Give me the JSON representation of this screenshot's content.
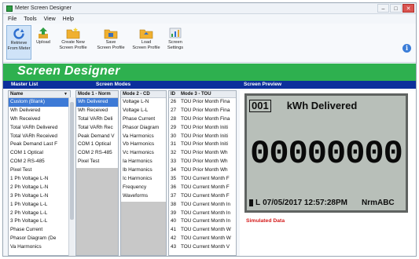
{
  "window": {
    "title": "Meter Screen Designer"
  },
  "menu": [
    "File",
    "Tools",
    "View",
    "Help"
  ],
  "toolbar": {
    "buttons": [
      {
        "label": "Retrieve\nFrom Meter",
        "icon": "refresh-icon",
        "active": true
      },
      {
        "label": "Upload",
        "icon": "upload-icon"
      },
      {
        "label": "Create New\nScreen Profile",
        "icon": "folder-new-icon"
      },
      {
        "label": "Save\nScreen Profile",
        "icon": "save-folder-icon"
      },
      {
        "label": "Load\nScreen Profile",
        "icon": "load-folder-icon"
      },
      {
        "label": "Screen\nSettings",
        "icon": "settings-chart-icon"
      }
    ]
  },
  "banner": {
    "title": "Screen Designer",
    "color": "#2eb04f"
  },
  "sections": {
    "master": "Master List",
    "modes": "Screen Modes",
    "preview": "Screen Preview"
  },
  "columns": {
    "name": {
      "header": "Name",
      "items": [
        "Custom (Blank)",
        "Wh Delivered",
        "Wh Received",
        "Total VARh Delivered",
        "Total VARh Received",
        "Peak Demand Last F",
        "COM 1 Optical",
        "COM 2 RS-485",
        "Pixel Test",
        "1 Ph Voltage L-N",
        "2 Ph Voltage L-N",
        "3 Ph Voltage L-N",
        "1 Ph Voltage L-L",
        "2 Ph Voltage L-L",
        "3 Ph Voltage L-L",
        "Phase Current",
        "Phasor Diagram (De",
        "Va Harmonics"
      ],
      "selected": 0
    },
    "mode1": {
      "header": "Mode 1 - Norm",
      "items": [
        "Wh Delivered",
        "Wh Received",
        "Total VARh Deli",
        "Total VARh Rec",
        "Peak Demand V",
        "COM 1 Optical",
        "COM 2 RS-485",
        "Pixel Test"
      ],
      "selected": 0
    },
    "mode2": {
      "header": "Mode 2 - CD",
      "items": [
        "Voltage L-N",
        "Voltage L-L",
        "Phase Current",
        "Phasor Diagram",
        "Va Harmonics",
        "Vb Harmonics",
        "Vc Harmonics",
        "Ia Harmonics",
        "Ib Harmonics",
        "Ic Harmonics",
        "Frequency",
        "Waveforms"
      ]
    },
    "mode3": {
      "header_id": "ID",
      "header": "Mode 3 - TOU",
      "items": [
        {
          "id": "26",
          "text": "TOU Prior Month Fina"
        },
        {
          "id": "27",
          "text": "TOU Prior Month Fina"
        },
        {
          "id": "28",
          "text": "TOU Prior Month Fina"
        },
        {
          "id": "29",
          "text": "TOU Prior Month Initi"
        },
        {
          "id": "30",
          "text": "TOU Prior Month Initi"
        },
        {
          "id": "31",
          "text": "TOU Prior Month Initi"
        },
        {
          "id": "32",
          "text": "TOU Prior Month Wh"
        },
        {
          "id": "33",
          "text": "TOU Prior Month Wh"
        },
        {
          "id": "34",
          "text": "TOU Prior Month Wh"
        },
        {
          "id": "35",
          "text": "TOU Current Month F"
        },
        {
          "id": "36",
          "text": "TOU Current Month F"
        },
        {
          "id": "37",
          "text": "TOU Current Month F"
        },
        {
          "id": "38",
          "text": "TOU Current Month In"
        },
        {
          "id": "39",
          "text": "TOU Current Month In"
        },
        {
          "id": "40",
          "text": "TOU Current Month In"
        },
        {
          "id": "41",
          "text": "TOU Current Month W"
        },
        {
          "id": "42",
          "text": "TOU Current Month W"
        },
        {
          "id": "43",
          "text": "TOU Current Month V"
        }
      ]
    }
  },
  "preview": {
    "screen_id": "001",
    "parameter": "kWh Delivered",
    "value": "00000000",
    "status_l": "L",
    "datetime": "07/05/2017 12:57:28PM",
    "mode": "NrmABC",
    "simulated_label": "Simulated Data",
    "lcd_color": "#b8bfb9"
  }
}
